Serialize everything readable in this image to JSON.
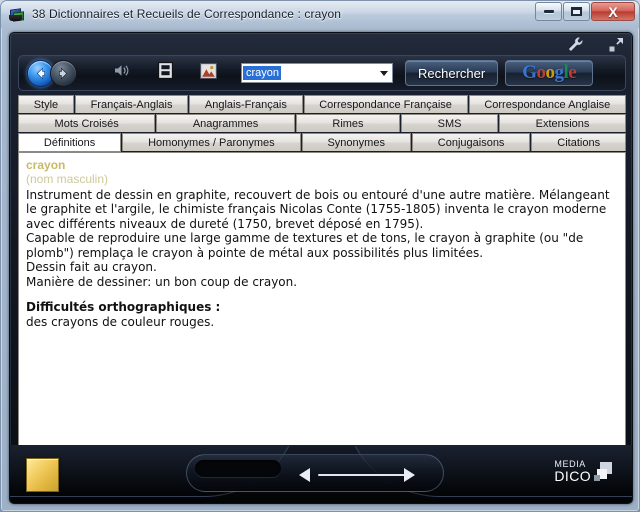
{
  "window": {
    "title": "38 Dictionnaires et Recueils de Correspondance : crayon",
    "icon": "books-icon",
    "controls": {
      "minimize": "minimize-button",
      "maximize": "maximize-button",
      "close_label": "X"
    }
  },
  "header_tools": {
    "settings_icon": "wrench-icon",
    "expand_icon": "expand-arrow-icon"
  },
  "toolbar": {
    "back_icon": "back-arrow-icon",
    "forward_icon": "forward-arrow-icon",
    "speaker_icon": "speaker-icon",
    "list_icon": "list-document-icon",
    "image_icon": "picture-icon",
    "search": {
      "value": "crayon",
      "placeholder": "crayon",
      "dropdown_icon": "chevron-down-icon"
    },
    "search_button_label": "Rechercher",
    "google_button": {
      "letters": [
        "G",
        "o",
        "o",
        "g",
        "l",
        "e"
      ]
    }
  },
  "tabs": {
    "row1": [
      {
        "label": "Style",
        "active": false
      },
      {
        "label": "Français-Anglais",
        "active": false
      },
      {
        "label": "Anglais-Français",
        "active": false
      },
      {
        "label": "Correspondance Française",
        "active": false
      },
      {
        "label": "Correspondance Anglaise",
        "active": false
      }
    ],
    "row2": [
      {
        "label": "Mots Croisés",
        "active": false
      },
      {
        "label": "Anagrammes",
        "active": false
      },
      {
        "label": "Rimes",
        "active": false
      },
      {
        "label": "SMS",
        "active": false
      },
      {
        "label": "Extensions",
        "active": false
      }
    ],
    "row3": [
      {
        "label": "Définitions",
        "active": true
      },
      {
        "label": "Homonymes / Paronymes",
        "active": false
      },
      {
        "label": "Synonymes",
        "active": false
      },
      {
        "label": "Conjugaisons",
        "active": false
      },
      {
        "label": "Citations",
        "active": false
      }
    ]
  },
  "entry": {
    "headword": "crayon",
    "part_of_speech": "(nom masculin)",
    "definition_lines": [
      "Instrument de dessin en graphite, recouvert de bois ou entouré d'une autre matière. Mélangeant le graphite et l'argile, le chimiste français Nicolas Conte (1755-1805) inventa le crayon moderne avec différents niveaux de dureté (1750, brevet déposé en 1795).",
      "Capable de reproduire une large gamme de textures et de tons, le crayon à graphite (ou \"de plomb\") remplaça le crayon à pointe de métal aux possibilités plus limitées.",
      "Dessin fait au crayon.",
      "Manière de dessiner: un bon coup de crayon."
    ],
    "difficulties_title": "Difficultés orthographiques :",
    "difficulties_text": "des crayons de couleur rouges."
  },
  "footer": {
    "gold_button": "bookmark-button",
    "prev_icon": "previous-arrow-icon",
    "next_icon": "next-arrow-icon",
    "brand_line1": "MEDIA",
    "brand_line2": "DICO"
  },
  "colors": {
    "accent_blue": "#2a6fd4",
    "headword_gold": "#c9b96b",
    "app_dark": "#11161f",
    "gold_button": "#f4cf63"
  }
}
